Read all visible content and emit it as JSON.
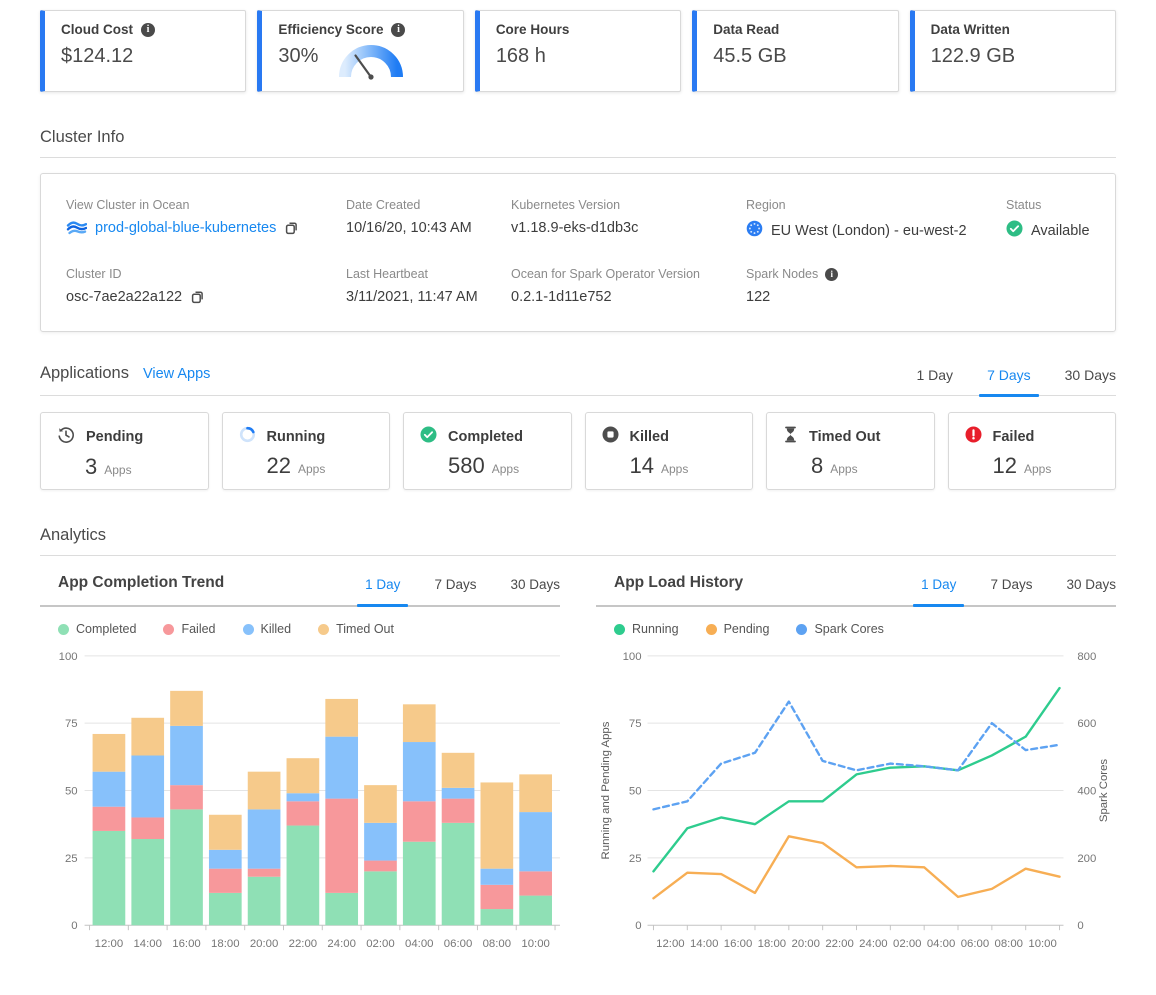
{
  "metrics": {
    "cards": [
      {
        "label": "Cloud Cost",
        "value": "$124.12",
        "has_info": true
      },
      {
        "label": "Efficiency Score",
        "value": "30%",
        "has_info": true,
        "gauge_percent": 30
      },
      {
        "label": "Core Hours",
        "value": "168 h"
      },
      {
        "label": "Data Read",
        "value": "45.5 GB"
      },
      {
        "label": "Data Written",
        "value": "122.9 GB"
      }
    ]
  },
  "cluster_info": {
    "title": "Cluster Info",
    "fields": [
      {
        "label": "View Cluster in Ocean",
        "value": "prod-global-blue-kubernetes"
      },
      {
        "label": "Date Created",
        "value": "10/16/20, 10:43 AM"
      },
      {
        "label": "Kubernetes Version",
        "value": "v1.18.9-eks-d1db3c"
      },
      {
        "label": "Region",
        "value": "EU West (London) - eu-west-2"
      },
      {
        "label": "Status",
        "value": "Available"
      },
      {
        "label": "Cluster ID",
        "value": "osc-7ae2a22a122"
      },
      {
        "label": "Last Heartbeat",
        "value": "3/11/2021, 11:47 AM"
      },
      {
        "label": "Ocean for Spark Operator Version",
        "value": "0.2.1-1d11e752"
      },
      {
        "label": "Spark Nodes",
        "value": "122"
      }
    ]
  },
  "applications": {
    "title": "Applications",
    "view_apps_label": "View Apps",
    "tabs": [
      {
        "label": "1 Day",
        "active": false
      },
      {
        "label": "7 Days",
        "active": true
      },
      {
        "label": "30 Days",
        "active": false
      }
    ],
    "cards": [
      {
        "label": "Pending",
        "value": "3",
        "unit": "Apps"
      },
      {
        "label": "Running",
        "value": "22",
        "unit": "Apps"
      },
      {
        "label": "Completed",
        "value": "580",
        "unit": "Apps"
      },
      {
        "label": "Killed",
        "value": "14",
        "unit": "Apps"
      },
      {
        "label": "Timed Out",
        "value": "8",
        "unit": "Apps"
      },
      {
        "label": "Failed",
        "value": "12",
        "unit": "Apps"
      }
    ]
  },
  "analytics": {
    "title": "Analytics"
  },
  "chart_data": [
    {
      "type": "bar",
      "stacked": true,
      "title": "App Completion Trend",
      "tabs": [
        "1 Day",
        "7 Days",
        "30 Days"
      ],
      "active_tab": "1 Day",
      "legend_position": "top",
      "grid": true,
      "categories": [
        "12:00",
        "14:00",
        "16:00",
        "18:00",
        "20:00",
        "22:00",
        "24:00",
        "02:00",
        "04:00",
        "06:00",
        "08:00",
        "10:00"
      ],
      "ylim": [
        0,
        100
      ],
      "yticks": [
        0,
        25,
        50,
        75,
        100
      ],
      "series": [
        {
          "name": "Completed",
          "color": "#8fe0b5",
          "values": [
            35,
            32,
            43,
            12,
            18,
            37,
            12,
            20,
            31,
            38,
            6,
            11
          ]
        },
        {
          "name": "Failed",
          "color": "#f7989b",
          "values": [
            9,
            8,
            9,
            9,
            3,
            9,
            35,
            4,
            15,
            9,
            9,
            9
          ]
        },
        {
          "name": "Killed",
          "color": "#87c1fb",
          "values": [
            13,
            23,
            22,
            7,
            22,
            3,
            23,
            14,
            22,
            4,
            6,
            22
          ]
        },
        {
          "name": "Timed Out",
          "color": "#f6ca8b",
          "values": [
            14,
            14,
            13,
            13,
            14,
            13,
            14,
            14,
            14,
            13,
            32,
            14
          ]
        }
      ]
    },
    {
      "type": "line",
      "title": "App Load History",
      "tabs": [
        "1 Day",
        "7 Days",
        "30 Days"
      ],
      "active_tab": "1 Day",
      "legend_position": "top",
      "grid": true,
      "x_labels": [
        "12:00",
        "14:00",
        "16:00",
        "18:00",
        "20:00",
        "22:00",
        "24:00",
        "02:00",
        "04:00",
        "06:00",
        "08:00",
        "10:00"
      ],
      "ylabel_left": "Running and Pending Apps",
      "ylabel_right": "Spark Cores",
      "ylim_left": [
        0,
        100
      ],
      "yticks_left": [
        0,
        25,
        50,
        75,
        100
      ],
      "ylim_right": [
        0,
        800
      ],
      "yticks_right": [
        0,
        200,
        400,
        600,
        800
      ],
      "series": [
        {
          "name": "Running",
          "color": "#2ecc8e",
          "axis": "left",
          "line_style": "solid",
          "values": [
            20,
            36,
            40,
            37.5,
            46,
            46,
            56,
            58.5,
            59,
            57.5,
            63,
            70,
            88
          ]
        },
        {
          "name": "Pending",
          "color": "#f7ae54",
          "axis": "left",
          "line_style": "solid",
          "values": [
            10,
            19.5,
            19,
            12,
            33,
            30.5,
            21.5,
            22,
            21.5,
            10.5,
            13.5,
            21,
            18
          ]
        },
        {
          "name": "Spark Cores",
          "color": "#5da2f2",
          "axis": "right",
          "line_style": "dashed",
          "values": [
            344,
            368,
            480,
            512,
            664,
            488,
            460,
            480,
            472,
            460,
            600,
            520,
            536
          ]
        }
      ]
    }
  ]
}
